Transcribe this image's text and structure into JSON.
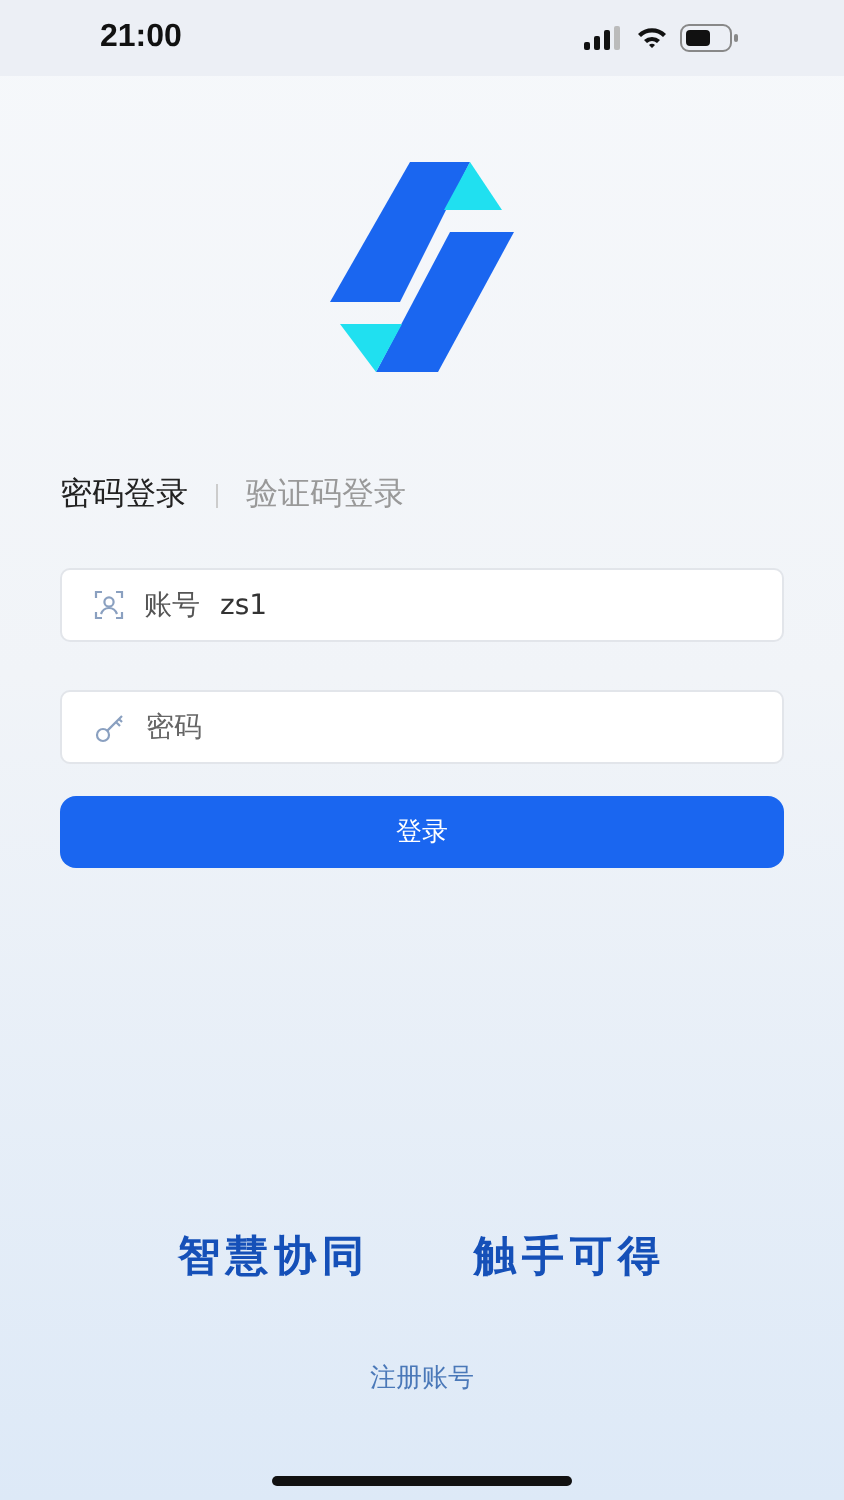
{
  "status_bar": {
    "time": "21:00"
  },
  "tabs": [
    {
      "label": "密码登录",
      "selected": true
    },
    {
      "label": "验证码登录",
      "selected": false
    }
  ],
  "fields": [
    {
      "kind": "account",
      "label": "账号",
      "value": "zs1"
    },
    {
      "kind": "password",
      "placeholder": "密码"
    }
  ],
  "login_button": "登录",
  "slogan": [
    "智慧协同",
    "触手可得"
  ],
  "register_link": "注册账号"
}
